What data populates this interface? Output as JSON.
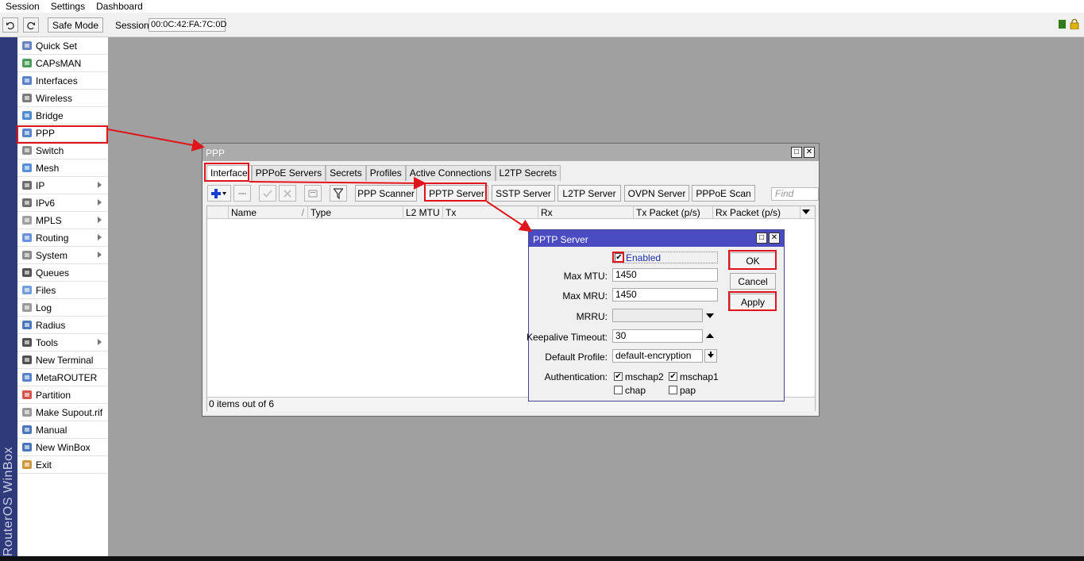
{
  "menubar": {
    "session": "Session",
    "settings": "Settings",
    "dashboard": "Dashboard"
  },
  "toolbar": {
    "safe_mode": "Safe Mode",
    "session_label": "Session:",
    "session_value": "00:0C:42:FA:7C:0D"
  },
  "brand": "RouterOS WinBox",
  "sidebar": {
    "items": [
      {
        "label": "Quick Set",
        "icon": "quick-set-icon",
        "submenu": false
      },
      {
        "label": "CAPsMAN",
        "icon": "capsman-icon",
        "submenu": false
      },
      {
        "label": "Interfaces",
        "icon": "interfaces-icon",
        "submenu": false
      },
      {
        "label": "Wireless",
        "icon": "wireless-icon",
        "submenu": false
      },
      {
        "label": "Bridge",
        "icon": "bridge-icon",
        "submenu": false
      },
      {
        "label": "PPP",
        "icon": "ppp-icon",
        "submenu": false
      },
      {
        "label": "Switch",
        "icon": "switch-icon",
        "submenu": false
      },
      {
        "label": "Mesh",
        "icon": "mesh-icon",
        "submenu": false
      },
      {
        "label": "IP",
        "icon": "ip-icon",
        "submenu": true
      },
      {
        "label": "IPv6",
        "icon": "ipv6-icon",
        "submenu": true
      },
      {
        "label": "MPLS",
        "icon": "mpls-icon",
        "submenu": true
      },
      {
        "label": "Routing",
        "icon": "routing-icon",
        "submenu": true
      },
      {
        "label": "System",
        "icon": "system-icon",
        "submenu": true
      },
      {
        "label": "Queues",
        "icon": "queues-icon",
        "submenu": false
      },
      {
        "label": "Files",
        "icon": "files-icon",
        "submenu": false
      },
      {
        "label": "Log",
        "icon": "log-icon",
        "submenu": false
      },
      {
        "label": "Radius",
        "icon": "radius-icon",
        "submenu": false
      },
      {
        "label": "Tools",
        "icon": "tools-icon",
        "submenu": true
      },
      {
        "label": "New Terminal",
        "icon": "terminal-icon",
        "submenu": false
      },
      {
        "label": "MetaROUTER",
        "icon": "metarouter-icon",
        "submenu": false
      },
      {
        "label": "Partition",
        "icon": "partition-icon",
        "submenu": false
      },
      {
        "label": "Make Supout.rif",
        "icon": "supout-icon",
        "submenu": false
      },
      {
        "label": "Manual",
        "icon": "manual-icon",
        "submenu": false
      },
      {
        "label": "New WinBox",
        "icon": "winbox-icon",
        "submenu": false
      },
      {
        "label": "Exit",
        "icon": "exit-icon",
        "submenu": false
      }
    ]
  },
  "ppp_window": {
    "title": "PPP",
    "tabs": [
      "Interface",
      "PPPoE Servers",
      "Secrets",
      "Profiles",
      "Active Connections",
      "L2TP Secrets"
    ],
    "buttons": [
      "PPP Scanner",
      "PPTP Server",
      "SSTP Server",
      "L2TP Server",
      "OVPN Server",
      "PPPoE Scan"
    ],
    "find_placeholder": "Find",
    "columns": [
      "Name",
      "Type",
      "L2 MTU",
      "Tx",
      "Rx",
      "Tx Packet (p/s)",
      "Rx Packet (p/s)"
    ],
    "status": "0 items out of 6"
  },
  "pptp_dialog": {
    "title": "PPTP Server",
    "enabled_label": "Enabled",
    "enabled": true,
    "max_mtu_label": "Max MTU:",
    "max_mtu": "1450",
    "max_mru_label": "Max MRU:",
    "max_mru": "1450",
    "mrru_label": "MRRU:",
    "mrru": "",
    "keepalive_label": "Keepalive Timeout:",
    "keepalive": "30",
    "profile_label": "Default Profile:",
    "profile": "default-encryption",
    "auth_label": "Authentication:",
    "auth": [
      {
        "label": "mschap2",
        "checked": true
      },
      {
        "label": "mschap1",
        "checked": true
      },
      {
        "label": "chap",
        "checked": false
      },
      {
        "label": "pap",
        "checked": false
      }
    ],
    "ok": "OK",
    "cancel": "Cancel",
    "apply": "Apply"
  },
  "colors": {
    "highlight": "#e0151b",
    "dialog_title": "#4a4bc0",
    "brand_band": "#2e3a7a"
  }
}
